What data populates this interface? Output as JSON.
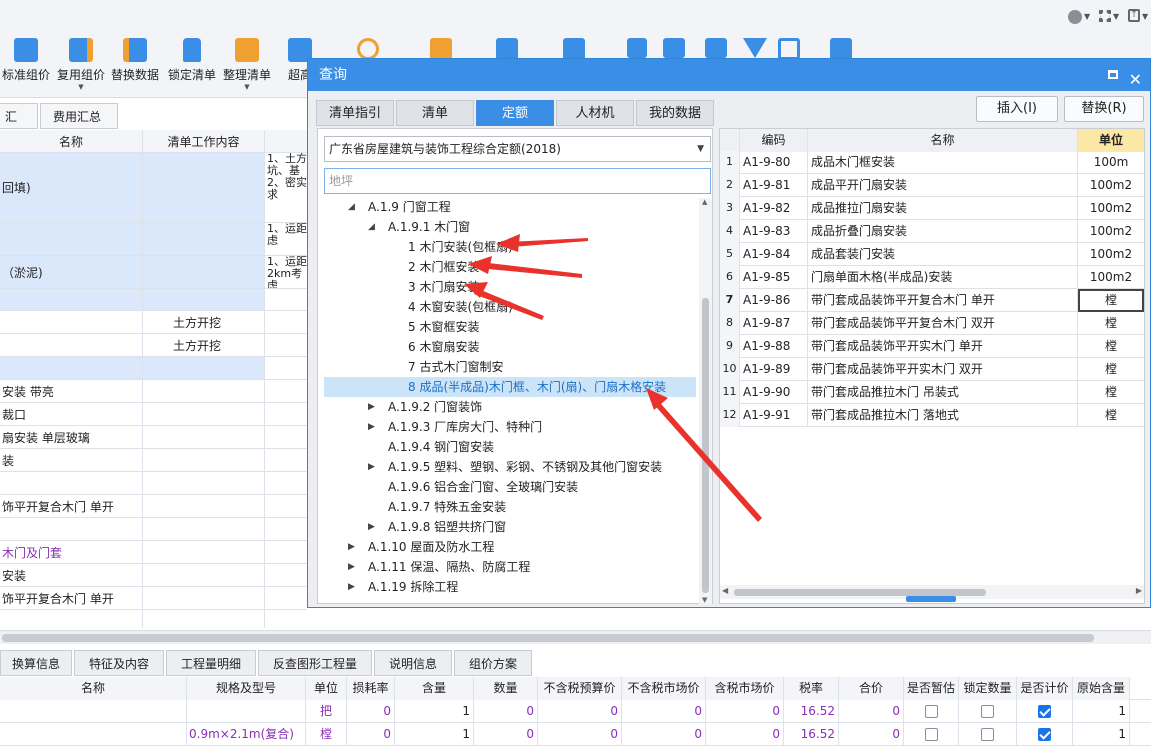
{
  "toolbar": {
    "items": [
      {
        "label": "标准组价",
        "icon": "standard-pricing-icon"
      },
      {
        "label": "复用组价",
        "icon": "reuse-pricing-icon"
      },
      {
        "label": "替换数据",
        "icon": "replace-data-icon"
      },
      {
        "label": "锁定清单",
        "icon": "lock-list-icon"
      },
      {
        "label": "整理清单",
        "icon": "organize-list-icon"
      },
      {
        "label": "超高",
        "icon": "super-high-icon"
      }
    ]
  },
  "left_tabs": [
    "汇总",
    "费用汇总"
  ],
  "left_grid": {
    "headers": [
      "名称",
      "清单工作内容",
      ""
    ],
    "rows": [
      {
        "c1": "回填)",
        "c2": "",
        "c3": "1、土方\n坑、基\n2、密实\n求",
        "h": 70,
        "hl": true
      },
      {
        "c1": "",
        "c2": "",
        "c3": "1、运距\n虑",
        "h": 33,
        "hl": true
      },
      {
        "c1": "（淤泥)",
        "c2": "",
        "c3": "1、运距\n2km考虑",
        "h": 33,
        "hl": true
      },
      {
        "c1": "",
        "c2": "",
        "c3": "",
        "h": 22,
        "hl": true
      },
      {
        "c1": "",
        "c2": "土方开挖",
        "c3": "",
        "h": 23,
        "hl": false
      },
      {
        "c1": "",
        "c2": "土方开挖",
        "c3": "",
        "h": 23,
        "hl": false
      },
      {
        "c1": "",
        "c2": "",
        "c3": "",
        "h": 23,
        "hl": true
      },
      {
        "c1": "安装 带亮",
        "c2": "",
        "c3": "",
        "h": 23,
        "hl": false
      },
      {
        "c1": "裁口",
        "c2": "",
        "c3": "",
        "h": 23,
        "hl": false
      },
      {
        "c1": "扇安装 单层玻璃",
        "c2": "",
        "c3": "",
        "h": 23,
        "hl": false
      },
      {
        "c1": "装",
        "c2": "",
        "c3": "",
        "h": 23,
        "hl": false
      },
      {
        "c1": "",
        "c2": "",
        "c3": "",
        "h": 23,
        "hl": false
      },
      {
        "c1": "饰平开复合木门 单开",
        "c2": "",
        "c3": "",
        "h": 23,
        "hl": false
      },
      {
        "c1": "",
        "c2": "",
        "c3": "",
        "h": 23,
        "hl": false
      },
      {
        "c1": "木门及门套",
        "c2": "",
        "c3": "",
        "h": 23,
        "hl": false,
        "purple": true
      },
      {
        "c1": "安装",
        "c2": "",
        "c3": "",
        "h": 23,
        "hl": false
      },
      {
        "c1": "饰平开复合木门 单开",
        "c2": "",
        "c3": "",
        "h": 23,
        "hl": false
      },
      {
        "c1": "",
        "c2": "",
        "c3": "",
        "h": 23,
        "hl": false
      }
    ]
  },
  "bottom_tabs": [
    "换算信息",
    "特征及内容",
    "工程量明细",
    "反查图形工程量",
    "说明信息",
    "组价方案"
  ],
  "bottom_grid": {
    "headers": [
      "名称",
      "规格及型号",
      "单位",
      "损耗率",
      "含量",
      "数量",
      "不含税预算价",
      "不含税市场价",
      "含税市场价",
      "税率",
      "合价",
      "是否暂估",
      "锁定数量",
      "是否计价",
      "原始含量"
    ],
    "rows": [
      {
        "name": "",
        "spec": "",
        "unit": "把",
        "loss": "0",
        "content": "1",
        "qty": "0",
        "p1": "0",
        "p2": "0",
        "p3": "0",
        "tax": "16.52",
        "total": "0",
        "est": false,
        "lock": false,
        "priced": true,
        "orig": "1"
      },
      {
        "name": "",
        "spec": "0.9m×2.1m(复合)",
        "unit": "樘",
        "loss": "0",
        "content": "1",
        "qty": "0",
        "p1": "0",
        "p2": "0",
        "p3": "0",
        "tax": "16.52",
        "total": "0",
        "est": false,
        "lock": false,
        "priced": true,
        "orig": "1"
      }
    ]
  },
  "dialog": {
    "title": "查询",
    "tabs": [
      "清单指引",
      "清单",
      "定额",
      "人材机",
      "我的数据"
    ],
    "active_tab": "定额",
    "insert_button": "插入(I)",
    "replace_button": "替换(R)",
    "quota_select": "广东省房屋建筑与装饰工程综合定额(2018)",
    "search_placeholder": "地坪",
    "tree": [
      {
        "text": "A.1.9 门窗工程",
        "indent": 0,
        "arrow": "◢"
      },
      {
        "text": "A.1.9.1 木门窗",
        "indent": 1,
        "arrow": "◢"
      },
      {
        "text": "1 木门安装(包框扇)",
        "indent": 2,
        "arrow": ""
      },
      {
        "text": "2 木门框安装",
        "indent": 2,
        "arrow": ""
      },
      {
        "text": "3 木门扇安装",
        "indent": 2,
        "arrow": ""
      },
      {
        "text": "4 木窗安装(包框扇)",
        "indent": 2,
        "arrow": ""
      },
      {
        "text": "5 木窗框安装",
        "indent": 2,
        "arrow": ""
      },
      {
        "text": "6 木窗扇安装",
        "indent": 2,
        "arrow": ""
      },
      {
        "text": "7 古式木门窗制安",
        "indent": 2,
        "arrow": ""
      },
      {
        "text": "8 成品(半成品)木门框、木门(扇)、门扇木格安装",
        "indent": 2,
        "arrow": "",
        "selected": true
      },
      {
        "text": "A.1.9.2 门窗装饰",
        "indent": 1,
        "arrow": "▶"
      },
      {
        "text": "A.1.9.3 厂库房大门、特种门",
        "indent": 1,
        "arrow": "▶"
      },
      {
        "text": "A.1.9.4 钢门窗安装",
        "indent": 1,
        "arrow": ""
      },
      {
        "text": "A.1.9.5 塑料、塑钢、彩钢、不锈钢及其他门窗安装",
        "indent": 1,
        "arrow": "▶"
      },
      {
        "text": "A.1.9.6 铝合金门窗、全玻璃门安装",
        "indent": 1,
        "arrow": ""
      },
      {
        "text": "A.1.9.7 特殊五金安装",
        "indent": 1,
        "arrow": ""
      },
      {
        "text": "A.1.9.8 铝塑共挤门窗",
        "indent": 1,
        "arrow": "▶"
      },
      {
        "text": "A.1.10 屋面及防水工程",
        "indent": 0,
        "arrow": "▶"
      },
      {
        "text": "A.1.11 保温、隔热、防腐工程",
        "indent": 0,
        "arrow": "▶"
      },
      {
        "text": "A.1.19 拆除工程",
        "indent": 0,
        "arrow": "▶"
      }
    ],
    "table": {
      "headers": [
        "",
        "编码",
        "名称",
        "单位"
      ],
      "rows": [
        {
          "no": "1",
          "code": "A1-9-80",
          "name": "成品木门框安装",
          "unit": "100m"
        },
        {
          "no": "2",
          "code": "A1-9-81",
          "name": "成品平开门扇安装",
          "unit": "100m2"
        },
        {
          "no": "3",
          "code": "A1-9-82",
          "name": "成品推拉门扇安装",
          "unit": "100m2"
        },
        {
          "no": "4",
          "code": "A1-9-83",
          "name": "成品折叠门扇安装",
          "unit": "100m2"
        },
        {
          "no": "5",
          "code": "A1-9-84",
          "name": "成品套装门安装",
          "unit": "100m2"
        },
        {
          "no": "6",
          "code": "A1-9-85",
          "name": "门扇单面木格(半成品)安装",
          "unit": "100m2"
        },
        {
          "no": "7",
          "code": "A1-9-86",
          "name": "带门套成品装饰平开复合木门 单开",
          "unit": "樘"
        },
        {
          "no": "8",
          "code": "A1-9-87",
          "name": "带门套成品装饰平开复合木门 双开",
          "unit": "樘"
        },
        {
          "no": "9",
          "code": "A1-9-88",
          "name": "带门套成品装饰平开实木门 单开",
          "unit": "樘"
        },
        {
          "no": "10",
          "code": "A1-9-89",
          "name": "带门套成品装饰平开实木门 双开",
          "unit": "樘"
        },
        {
          "no": "11",
          "code": "A1-9-90",
          "name": "带门套成品推拉木门 吊装式",
          "unit": "樘"
        },
        {
          "no": "12",
          "code": "A1-9-91",
          "name": "带门套成品推拉木门 落地式",
          "unit": "樘"
        }
      ]
    }
  },
  "colors": {
    "accent": "#3a8ee6",
    "highlight_row": "#dbe8fb",
    "purple_text": "#8a2fb5",
    "annotation_red": "#e8322b"
  }
}
